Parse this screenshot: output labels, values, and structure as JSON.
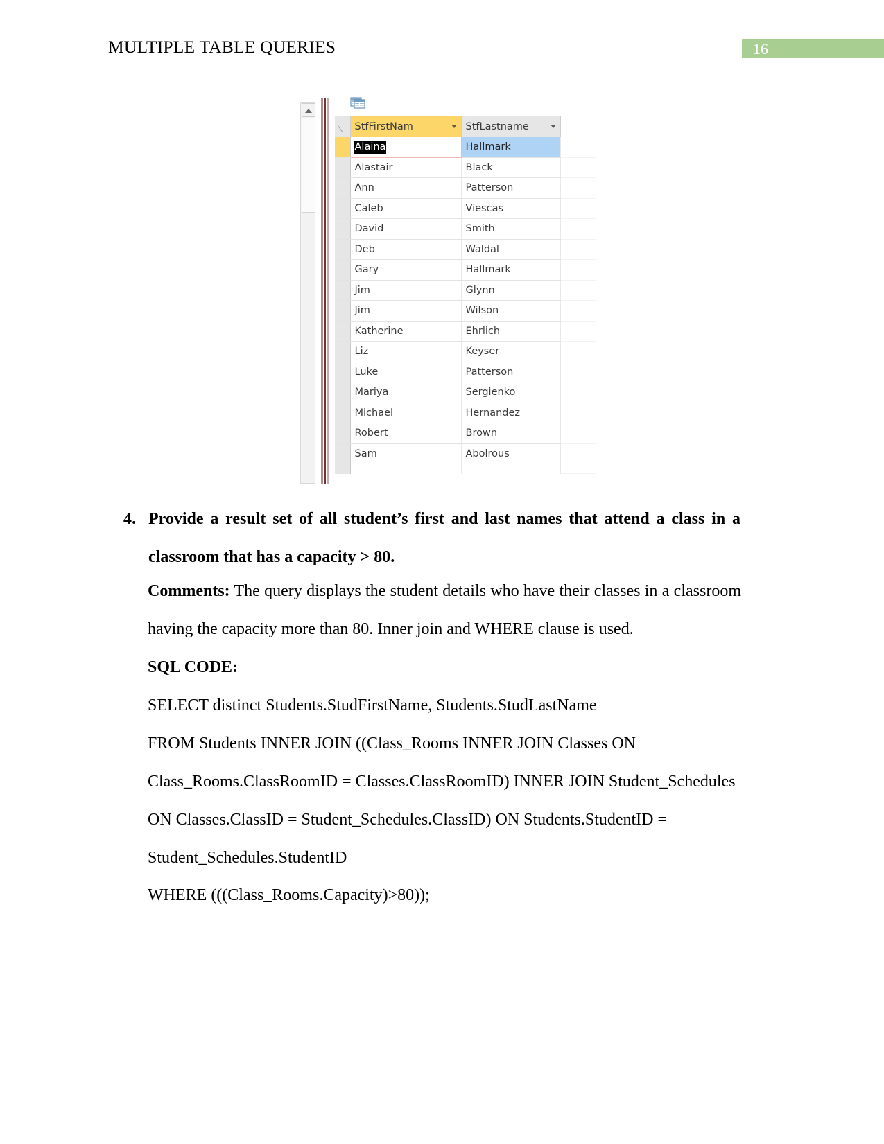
{
  "header": {
    "title": "MULTIPLE TABLE QUERIES",
    "page_number": "16",
    "badge_color": "#A9CE92"
  },
  "screenshot": {
    "icon_name": "datasheet-view-icon",
    "columns": [
      {
        "key": "first",
        "label": "StfFirstNam",
        "highlight_color": "#FCD669",
        "sorted": true
      },
      {
        "key": "last",
        "label": "StfLastname",
        "highlight_color": "#E6E6E6",
        "sorted": false
      }
    ],
    "rows": [
      {
        "first": "Alaina",
        "last": "Hallmark",
        "current": true
      },
      {
        "first": "Alastair",
        "last": "Black",
        "current": false
      },
      {
        "first": "Ann",
        "last": "Patterson",
        "current": false
      },
      {
        "first": "Caleb",
        "last": "Viescas",
        "current": false
      },
      {
        "first": "David",
        "last": "Smith",
        "current": false
      },
      {
        "first": "Deb",
        "last": "Waldal",
        "current": false
      },
      {
        "first": "Gary",
        "last": "Hallmark",
        "current": false
      },
      {
        "first": "Jim",
        "last": "Glynn",
        "current": false
      },
      {
        "first": "Jim",
        "last": "Wilson",
        "current": false
      },
      {
        "first": "Katherine",
        "last": "Ehrlich",
        "current": false
      },
      {
        "first": "Liz",
        "last": "Keyser",
        "current": false
      },
      {
        "first": "Luke",
        "last": "Patterson",
        "current": false
      },
      {
        "first": "Mariya",
        "last": "Sergienko",
        "current": false
      },
      {
        "first": "Michael",
        "last": "Hernandez",
        "current": false
      },
      {
        "first": "Robert",
        "last": "Brown",
        "current": false
      },
      {
        "first": "Sam",
        "last": "Abolrous",
        "current": false
      }
    ],
    "selection": {
      "selected_cell_value": "Alaina",
      "selected_row_value": "Hallmark",
      "selected_text_color": "#FFFFFF",
      "selected_text_background": "#000000",
      "row_highlight_color": "#AFD3F5"
    }
  },
  "question": {
    "number": "4.",
    "text": "Provide a result set of all student’s first and last names that attend a class in a classroom that has a capacity > 80."
  },
  "comments": {
    "label": "Comments:",
    "text": " The query displays the student details who have their classes in a classroom having the capacity more than 80. Inner join and WHERE clause is used."
  },
  "sql": {
    "heading": "SQL CODE:",
    "lines": [
      "SELECT distinct Students.StudFirstName, Students.StudLastName",
      "FROM Students INNER JOIN ((Class_Rooms INNER JOIN Classes ON Class_Rooms.ClassRoomID = Classes.ClassRoomID) INNER JOIN Student_Schedules ON Classes.ClassID = Student_Schedules.ClassID) ON Students.StudentID = Student_Schedules.StudentID",
      "WHERE (((Class_Rooms.Capacity)>80));"
    ],
    "line_select": "SELECT distinct Students.StudFirstName, Students.StudLastName",
    "line_from_1": "FROM Students INNER JOIN ((Class_Rooms INNER JOIN Classes ON",
    "line_from_2": "Class_Rooms.ClassRoomID = Classes.ClassRoomID) INNER JOIN Student_Schedules",
    "line_from_3": "ON Classes.ClassID = Student_Schedules.ClassID) ON Students.StudentID =",
    "line_from_4": "Student_Schedules.StudentID",
    "line_where": "WHERE (((Class_Rooms.Capacity)>80));"
  }
}
